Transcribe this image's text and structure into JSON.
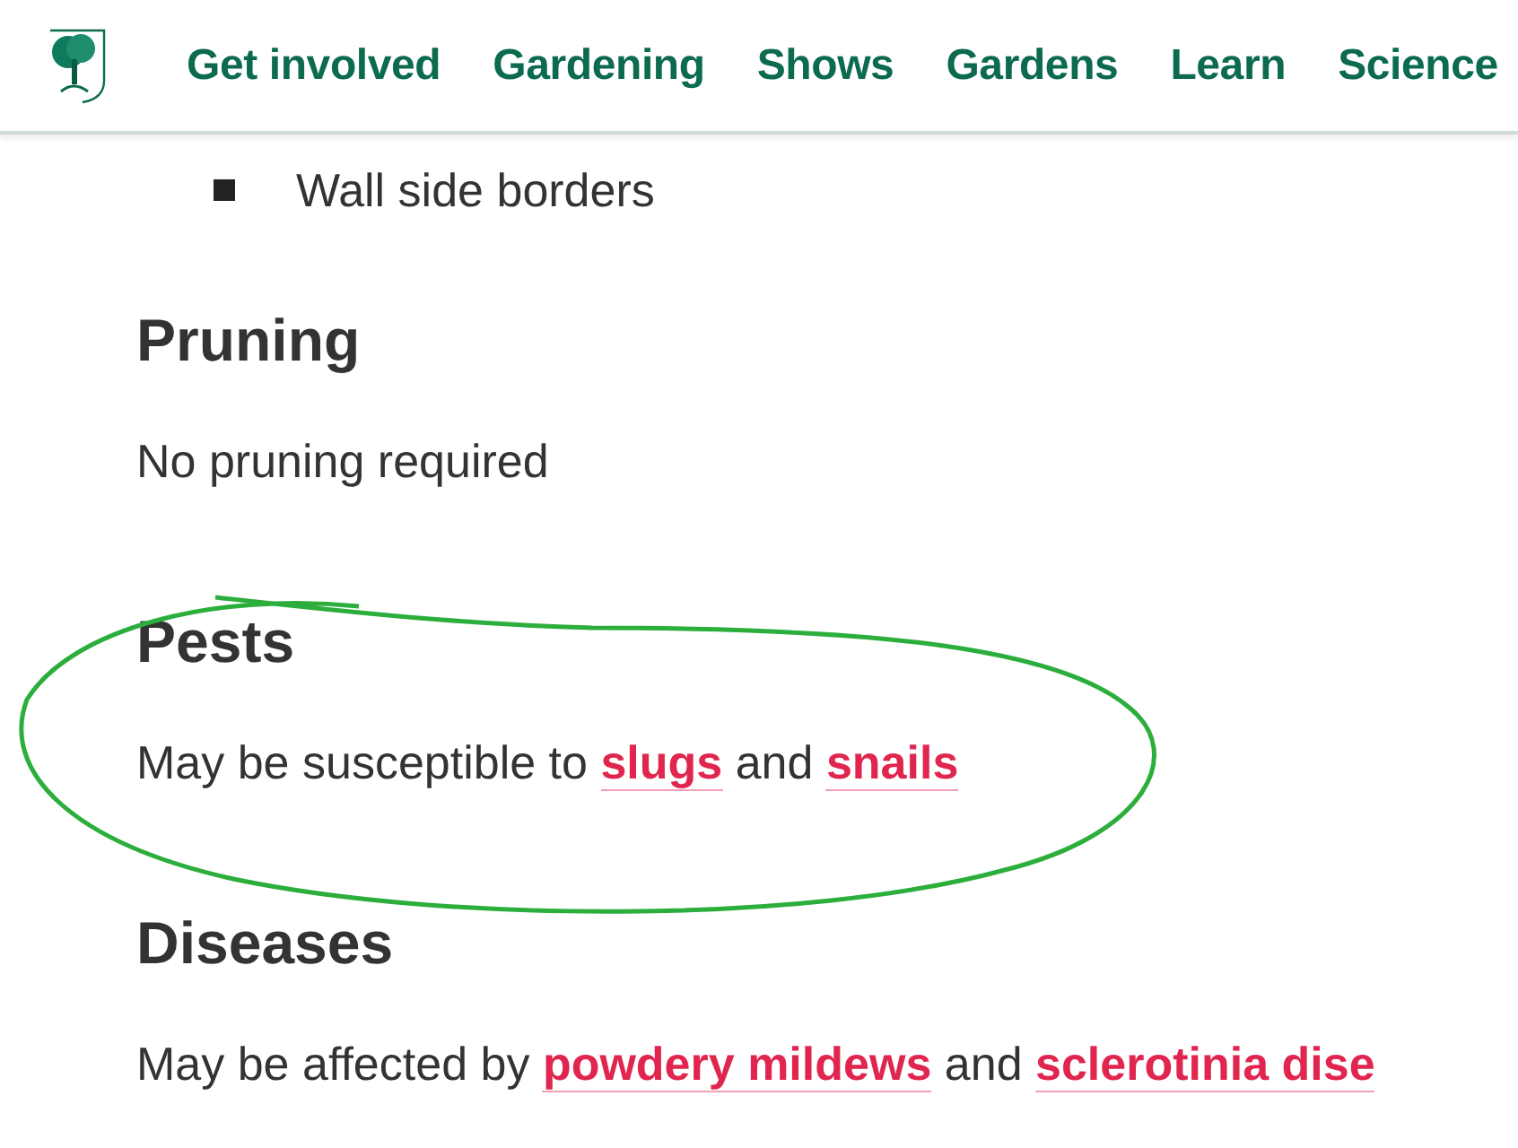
{
  "nav": {
    "items": [
      {
        "label": "Get involved"
      },
      {
        "label": "Gardening"
      },
      {
        "label": "Shows"
      },
      {
        "label": "Gardens"
      },
      {
        "label": "Learn"
      },
      {
        "label": "Science"
      }
    ]
  },
  "list_items": [
    "Wall side borders"
  ],
  "sections": [
    {
      "heading": "Pruning",
      "paragraph": [
        {
          "kind": "text",
          "text": "No pruning required"
        }
      ]
    },
    {
      "heading": "Pests",
      "highlighted": true,
      "paragraph": [
        {
          "kind": "text",
          "text": "May be susceptible to "
        },
        {
          "kind": "link",
          "text": "slugs"
        },
        {
          "kind": "text",
          "text": " and "
        },
        {
          "kind": "link",
          "text": "snails"
        }
      ]
    },
    {
      "heading": "Diseases",
      "paragraph": [
        {
          "kind": "text",
          "text": "May be affected by "
        },
        {
          "kind": "link",
          "text": "powdery mildews"
        },
        {
          "kind": "text",
          "text": " and "
        },
        {
          "kind": "link",
          "text": "sclerotinia dise"
        }
      ]
    }
  ]
}
